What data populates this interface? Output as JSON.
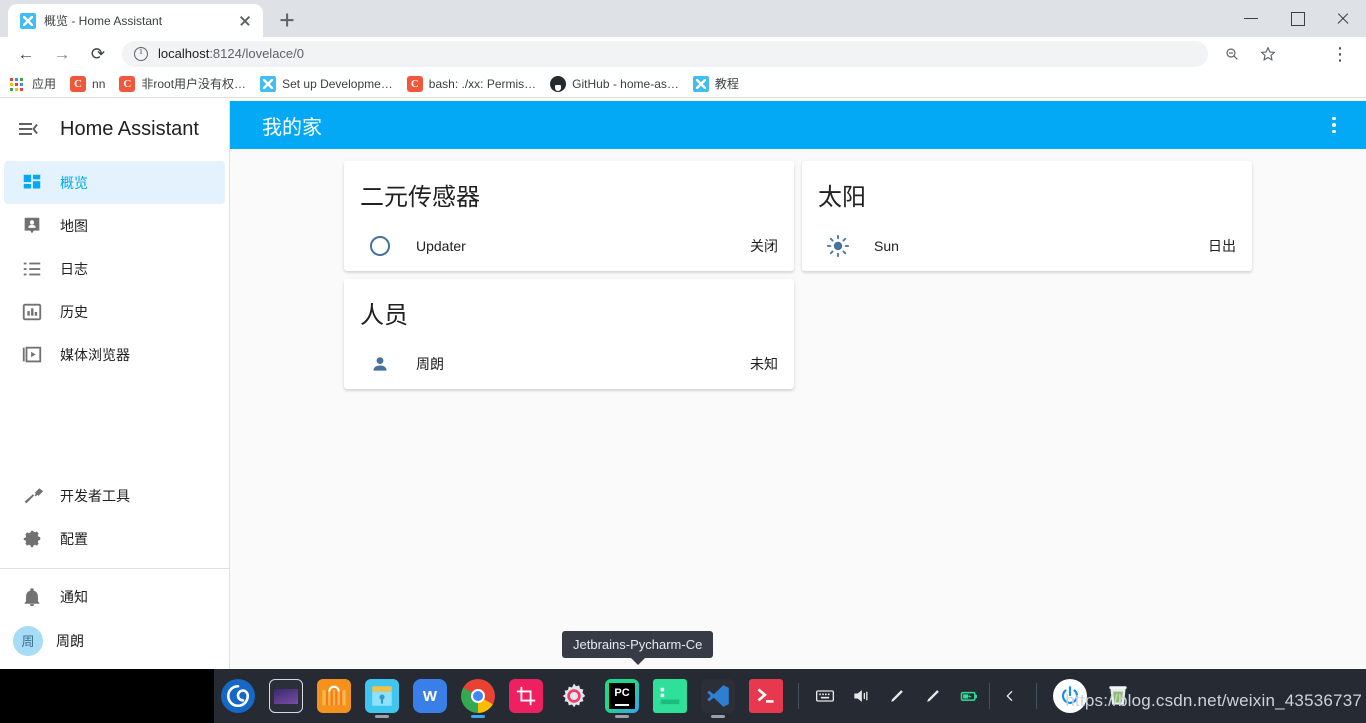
{
  "browser": {
    "tab": {
      "title": "概览 - Home Assistant",
      "favicon": "home-assistant-icon"
    },
    "newtab_label": "+",
    "window_controls": {
      "minimize": "—",
      "maximize": "□",
      "close": "✕"
    },
    "toolbar": {
      "back": "←",
      "forward": "→",
      "reload": "⟳",
      "url_prefix": "localhost",
      "url_suffix": ":8124/lovelace/0",
      "url_full": "localhost:8124/lovelace/0",
      "zoom_icon": "zoom-out-icon",
      "bookmark_icon": "star-icon",
      "profile_icon": "profile-avatar-icon",
      "menu_icon": "three-dot-menu-icon"
    },
    "bookmarks": [
      {
        "label": "应用",
        "icon": "apps-grid-icon"
      },
      {
        "label": "nn",
        "icon": "csdn-icon"
      },
      {
        "label": "非root用户没有权…",
        "icon": "csdn-icon"
      },
      {
        "label": "Set up Developme…",
        "icon": "home-assistant-icon"
      },
      {
        "label": "bash: ./xx: Permis…",
        "icon": "csdn-icon"
      },
      {
        "label": "GitHub - home-as…",
        "icon": "github-icon"
      },
      {
        "label": "教程",
        "icon": "home-assistant-icon"
      }
    ]
  },
  "sidebar": {
    "menu_icon": "menu-collapse-icon",
    "title": "Home Assistant",
    "items": [
      {
        "label": "概览",
        "icon": "dashboard-grid-icon",
        "active": true
      },
      {
        "label": "地图",
        "icon": "map-badge-icon",
        "active": false
      },
      {
        "label": "日志",
        "icon": "logbook-list-icon",
        "active": false
      },
      {
        "label": "历史",
        "icon": "history-chart-icon",
        "active": false
      },
      {
        "label": "媒体浏览器",
        "icon": "media-browser-icon",
        "active": false
      }
    ],
    "tools": [
      {
        "label": "开发者工具",
        "icon": "hammer-icon"
      },
      {
        "label": "配置",
        "icon": "gear-icon"
      }
    ],
    "footer": [
      {
        "label": "通知",
        "icon": "bell-icon"
      }
    ],
    "user": {
      "label": "周朗",
      "initial": "周"
    }
  },
  "app": {
    "header_title": "我的家",
    "header_menu_icon": "three-dot-menu-icon",
    "accent_color": "#03a9f4",
    "cards": [
      {
        "title": "二元传感器",
        "rows": [
          {
            "name": "Updater",
            "state": "关闭",
            "icon": "binary-sensor-circle-icon"
          }
        ]
      },
      {
        "title": "太阳",
        "rows": [
          {
            "name": "Sun",
            "state": "日出",
            "icon": "sun-icon"
          }
        ]
      },
      {
        "title": "人员",
        "rows": [
          {
            "name": "周朗",
            "state": "未知",
            "icon": "person-icon"
          }
        ]
      }
    ]
  },
  "desktop": {
    "tooltip": "Jetbrains-Pycharm-Ce",
    "watermark": "https://blog.csdn.net/weixin_43536737",
    "taskbar": {
      "apps": [
        {
          "name": "deepin-launcher-icon",
          "running": false
        },
        {
          "name": "display-monitor-icon",
          "running": false
        },
        {
          "name": "app-store-icon",
          "running": false
        },
        {
          "name": "file-manager-icon",
          "running": true
        },
        {
          "name": "wps-office-icon",
          "running": false
        },
        {
          "name": "google-chrome-icon",
          "running": true
        },
        {
          "name": "screenshot-tool-icon",
          "running": false
        },
        {
          "name": "settings-gear-icon",
          "running": false
        },
        {
          "name": "pycharm-ce-icon",
          "running": true
        },
        {
          "name": "terminal-green-icon",
          "running": false
        },
        {
          "name": "vscode-icon",
          "running": true
        },
        {
          "name": "terminal-red-icon",
          "running": false
        }
      ],
      "tray": [
        {
          "name": "keyboard-icon"
        },
        {
          "name": "volume-icon"
        },
        {
          "name": "brightness-pen-icon"
        },
        {
          "name": "brightness-pen-2-icon"
        },
        {
          "name": "battery-icon"
        },
        {
          "name": "tray-expand-chevron-icon"
        }
      ],
      "power_icon": "power-button-icon",
      "trash_icon": "trash-bin-icon"
    }
  }
}
